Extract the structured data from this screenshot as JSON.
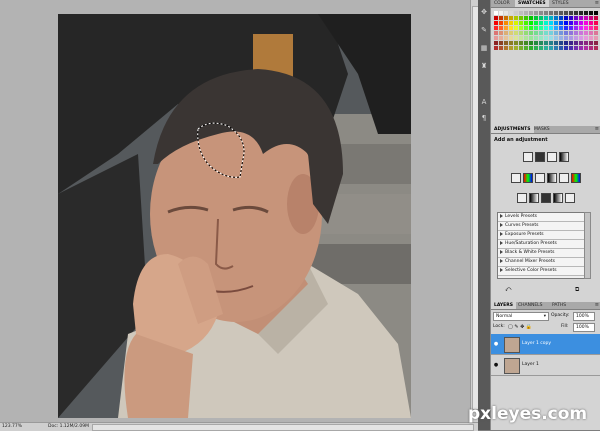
{
  "status": {
    "zoom": "123.77%",
    "doc": "Doc: 1.12M/2.09M"
  },
  "panels": {
    "color_tabs": [
      "COLOR",
      "SWATCHES",
      "STYLES"
    ],
    "adjust_tabs": [
      "ADJUSTMENTS",
      "MASKS"
    ],
    "adjust_heading": "Add an adjustment",
    "presets": [
      "Levels Presets",
      "Curves Presets",
      "Exposure Presets",
      "Hue/Saturation Presets",
      "Black & White Presets",
      "Channel Mixer Presets",
      "Selective Color Presets"
    ],
    "layer_tabs": [
      "LAYERS",
      "CHANNELS",
      "PATHS"
    ],
    "blend_mode": "Normal",
    "opacity_label": "Opacity:",
    "opacity_value": "100%",
    "lock_label": "Lock:",
    "fill_label": "Fill:",
    "fill_value": "100%",
    "layers": [
      "Layer 1 copy",
      "Layer 1"
    ]
  },
  "icons": {
    "tools": [
      "move-icon",
      "brush-icon",
      "type-icon",
      "paragraph-icon",
      "stamp-icon",
      "fill-icon"
    ],
    "menu": "panel-menu-icon"
  },
  "watermark": "pxleyes.com",
  "colors": {
    "selected_layer": "#3c8fe0",
    "dock": "#d4d4d4",
    "canvas_bg": "#b3b3b3"
  }
}
